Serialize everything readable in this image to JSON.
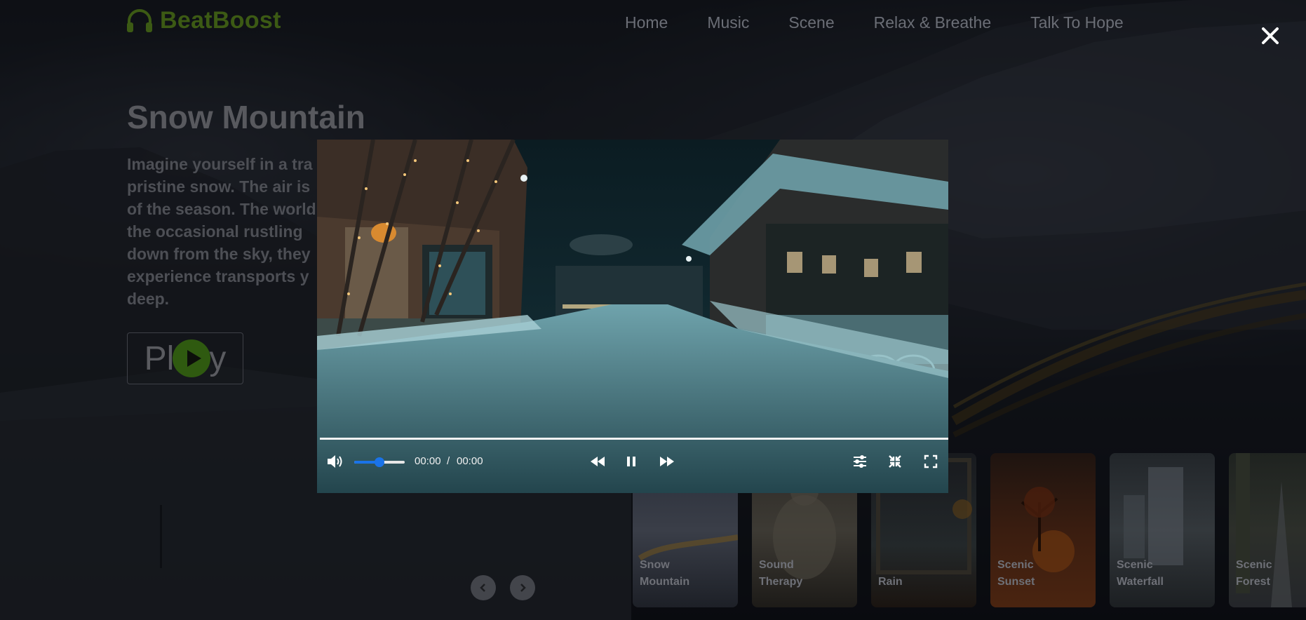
{
  "header": {
    "brand": "BeatBoost",
    "nav": [
      "Home",
      "Music",
      "Scene",
      "Relax & Breathe",
      "Talk To Hope"
    ]
  },
  "hero": {
    "title": "Snow Mountain",
    "description": "Imagine yourself in a tra... pristine snow. The air is... of the season. The world... the occasional rustling ... down from the sky, they... experience transports y... deep.",
    "lines": [
      "Imagine yourself in a tra",
      "pristine snow. The air is",
      "of the season. The world",
      "the occasional rustling",
      "down from the sky, they",
      "experience transports y",
      "deep."
    ],
    "play_left": "Pl",
    "play_right": "y"
  },
  "player": {
    "current_time": "00:00",
    "separator": "/",
    "duration": "00:00",
    "volume": 0.5,
    "progress": 1.0
  },
  "cards": [
    {
      "label_1": "Snow",
      "label_2": "Mountain"
    },
    {
      "label_1": "Sound",
      "label_2": "Therapy"
    },
    {
      "label_1": "Rain",
      "label_2": ""
    },
    {
      "label_1": "Scenic",
      "label_2": "Sunset"
    },
    {
      "label_1": "Scenic",
      "label_2": "Waterfall"
    },
    {
      "label_1": "Scenic",
      "label_2": "Forest"
    }
  ],
  "colors": {
    "brand": "#3c5a14",
    "volume_accent": "#1a73e8"
  }
}
